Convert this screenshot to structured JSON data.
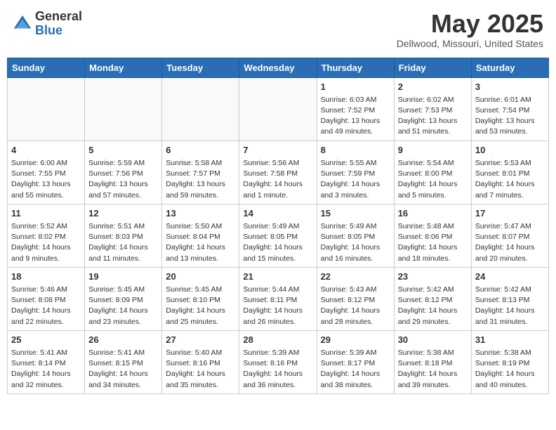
{
  "header": {
    "logo_general": "General",
    "logo_blue": "Blue",
    "month_title": "May 2025",
    "location": "Dellwood, Missouri, United States"
  },
  "weekdays": [
    "Sunday",
    "Monday",
    "Tuesday",
    "Wednesday",
    "Thursday",
    "Friday",
    "Saturday"
  ],
  "weeks": [
    [
      {
        "day": "",
        "info": ""
      },
      {
        "day": "",
        "info": ""
      },
      {
        "day": "",
        "info": ""
      },
      {
        "day": "",
        "info": ""
      },
      {
        "day": "1",
        "info": "Sunrise: 6:03 AM\nSunset: 7:52 PM\nDaylight: 13 hours\nand 49 minutes."
      },
      {
        "day": "2",
        "info": "Sunrise: 6:02 AM\nSunset: 7:53 PM\nDaylight: 13 hours\nand 51 minutes."
      },
      {
        "day": "3",
        "info": "Sunrise: 6:01 AM\nSunset: 7:54 PM\nDaylight: 13 hours\nand 53 minutes."
      }
    ],
    [
      {
        "day": "4",
        "info": "Sunrise: 6:00 AM\nSunset: 7:55 PM\nDaylight: 13 hours\nand 55 minutes."
      },
      {
        "day": "5",
        "info": "Sunrise: 5:59 AM\nSunset: 7:56 PM\nDaylight: 13 hours\nand 57 minutes."
      },
      {
        "day": "6",
        "info": "Sunrise: 5:58 AM\nSunset: 7:57 PM\nDaylight: 13 hours\nand 59 minutes."
      },
      {
        "day": "7",
        "info": "Sunrise: 5:56 AM\nSunset: 7:58 PM\nDaylight: 14 hours\nand 1 minute."
      },
      {
        "day": "8",
        "info": "Sunrise: 5:55 AM\nSunset: 7:59 PM\nDaylight: 14 hours\nand 3 minutes."
      },
      {
        "day": "9",
        "info": "Sunrise: 5:54 AM\nSunset: 8:00 PM\nDaylight: 14 hours\nand 5 minutes."
      },
      {
        "day": "10",
        "info": "Sunrise: 5:53 AM\nSunset: 8:01 PM\nDaylight: 14 hours\nand 7 minutes."
      }
    ],
    [
      {
        "day": "11",
        "info": "Sunrise: 5:52 AM\nSunset: 8:02 PM\nDaylight: 14 hours\nand 9 minutes."
      },
      {
        "day": "12",
        "info": "Sunrise: 5:51 AM\nSunset: 8:03 PM\nDaylight: 14 hours\nand 11 minutes."
      },
      {
        "day": "13",
        "info": "Sunrise: 5:50 AM\nSunset: 8:04 PM\nDaylight: 14 hours\nand 13 minutes."
      },
      {
        "day": "14",
        "info": "Sunrise: 5:49 AM\nSunset: 8:05 PM\nDaylight: 14 hours\nand 15 minutes."
      },
      {
        "day": "15",
        "info": "Sunrise: 5:49 AM\nSunset: 8:05 PM\nDaylight: 14 hours\nand 16 minutes."
      },
      {
        "day": "16",
        "info": "Sunrise: 5:48 AM\nSunset: 8:06 PM\nDaylight: 14 hours\nand 18 minutes."
      },
      {
        "day": "17",
        "info": "Sunrise: 5:47 AM\nSunset: 8:07 PM\nDaylight: 14 hours\nand 20 minutes."
      }
    ],
    [
      {
        "day": "18",
        "info": "Sunrise: 5:46 AM\nSunset: 8:08 PM\nDaylight: 14 hours\nand 22 minutes."
      },
      {
        "day": "19",
        "info": "Sunrise: 5:45 AM\nSunset: 8:09 PM\nDaylight: 14 hours\nand 23 minutes."
      },
      {
        "day": "20",
        "info": "Sunrise: 5:45 AM\nSunset: 8:10 PM\nDaylight: 14 hours\nand 25 minutes."
      },
      {
        "day": "21",
        "info": "Sunrise: 5:44 AM\nSunset: 8:11 PM\nDaylight: 14 hours\nand 26 minutes."
      },
      {
        "day": "22",
        "info": "Sunrise: 5:43 AM\nSunset: 8:12 PM\nDaylight: 14 hours\nand 28 minutes."
      },
      {
        "day": "23",
        "info": "Sunrise: 5:42 AM\nSunset: 8:12 PM\nDaylight: 14 hours\nand 29 minutes."
      },
      {
        "day": "24",
        "info": "Sunrise: 5:42 AM\nSunset: 8:13 PM\nDaylight: 14 hours\nand 31 minutes."
      }
    ],
    [
      {
        "day": "25",
        "info": "Sunrise: 5:41 AM\nSunset: 8:14 PM\nDaylight: 14 hours\nand 32 minutes."
      },
      {
        "day": "26",
        "info": "Sunrise: 5:41 AM\nSunset: 8:15 PM\nDaylight: 14 hours\nand 34 minutes."
      },
      {
        "day": "27",
        "info": "Sunrise: 5:40 AM\nSunset: 8:16 PM\nDaylight: 14 hours\nand 35 minutes."
      },
      {
        "day": "28",
        "info": "Sunrise: 5:39 AM\nSunset: 8:16 PM\nDaylight: 14 hours\nand 36 minutes."
      },
      {
        "day": "29",
        "info": "Sunrise: 5:39 AM\nSunset: 8:17 PM\nDaylight: 14 hours\nand 38 minutes."
      },
      {
        "day": "30",
        "info": "Sunrise: 5:38 AM\nSunset: 8:18 PM\nDaylight: 14 hours\nand 39 minutes."
      },
      {
        "day": "31",
        "info": "Sunrise: 5:38 AM\nSunset: 8:19 PM\nDaylight: 14 hours\nand 40 minutes."
      }
    ]
  ]
}
